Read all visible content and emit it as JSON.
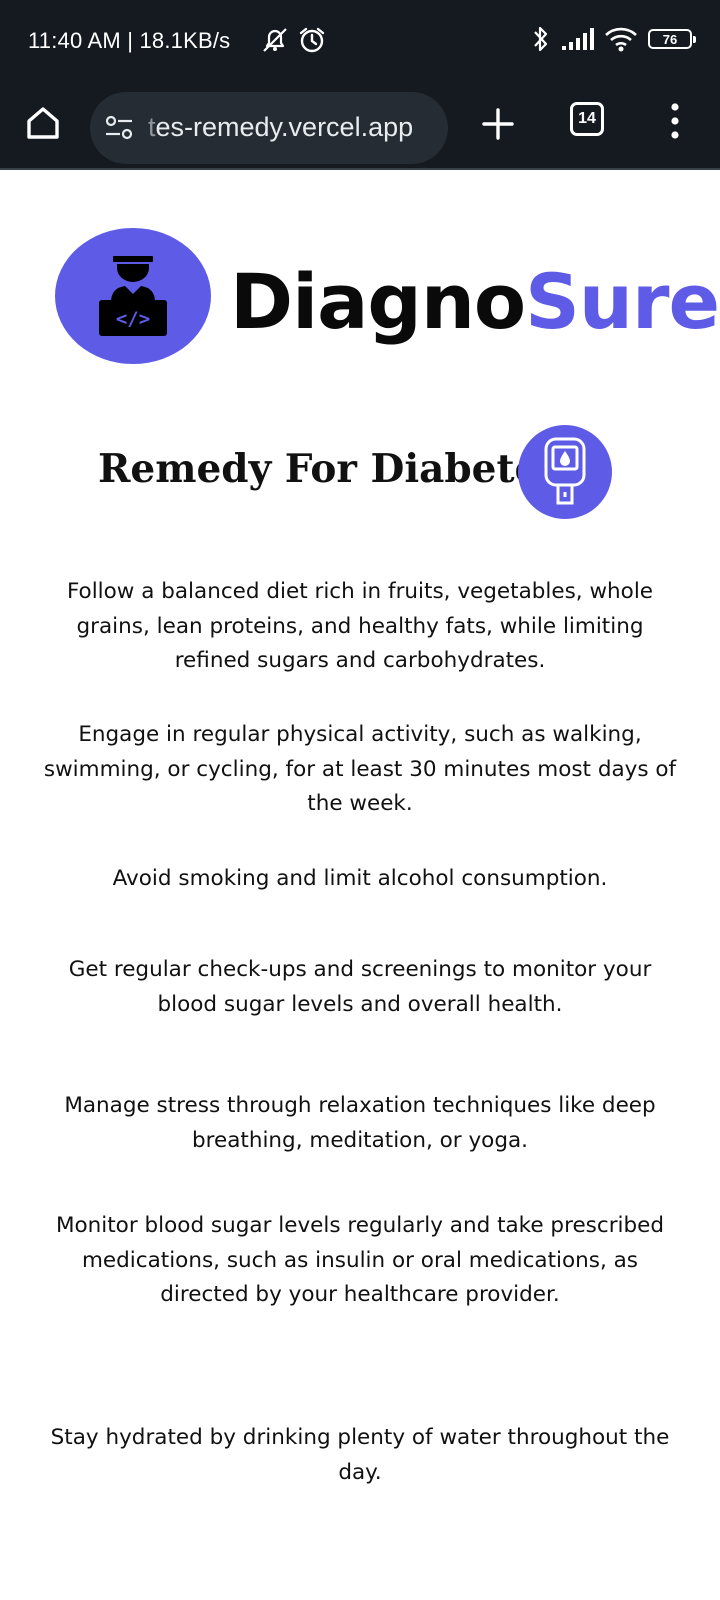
{
  "status_bar": {
    "time_and_speed": "11:40 AM | 18.1KB/s",
    "battery_level": "76",
    "icons": [
      "alarm-off-icon",
      "alarm-clock-icon",
      "bluetooth-icon",
      "signal-icon",
      "wifi-icon",
      "battery-icon"
    ]
  },
  "browser": {
    "url_faded": "t",
    "url": "es-remedy.vercel.app",
    "tab_count": "14",
    "icons": [
      "home-icon",
      "site-settings-icon",
      "new-tab-icon",
      "tabs-icon",
      "more-menu-icon"
    ]
  },
  "brand": {
    "name_part1": "Diagno",
    "name_part2": "Sure",
    "logo_icon": "developer-laptop-icon",
    "accent_color": "#5e5ce6"
  },
  "page": {
    "title": "Remedy For Diabetes",
    "title_icon": "glucose-meter-icon",
    "tips": [
      "Follow a balanced diet rich in fruits, vegetables, whole grains, lean proteins, and healthy fats, while limiting refined sugars and carbohydrates.",
      "Engage in regular physical activity, such as walking, swimming, or cycling, for at least 30 minutes most days of the week.",
      "Avoid smoking and limit alcohol consumption.",
      "Get regular check-ups and screenings to monitor your blood sugar levels and overall health.",
      "Manage stress through relaxation techniques like deep breathing, meditation, or yoga.",
      "Monitor blood sugar levels regularly and take prescribed medications, such as insulin or oral medications, as directed by your healthcare provider.",
      "Stay hydrated by drinking plenty of water throughout the day."
    ]
  }
}
